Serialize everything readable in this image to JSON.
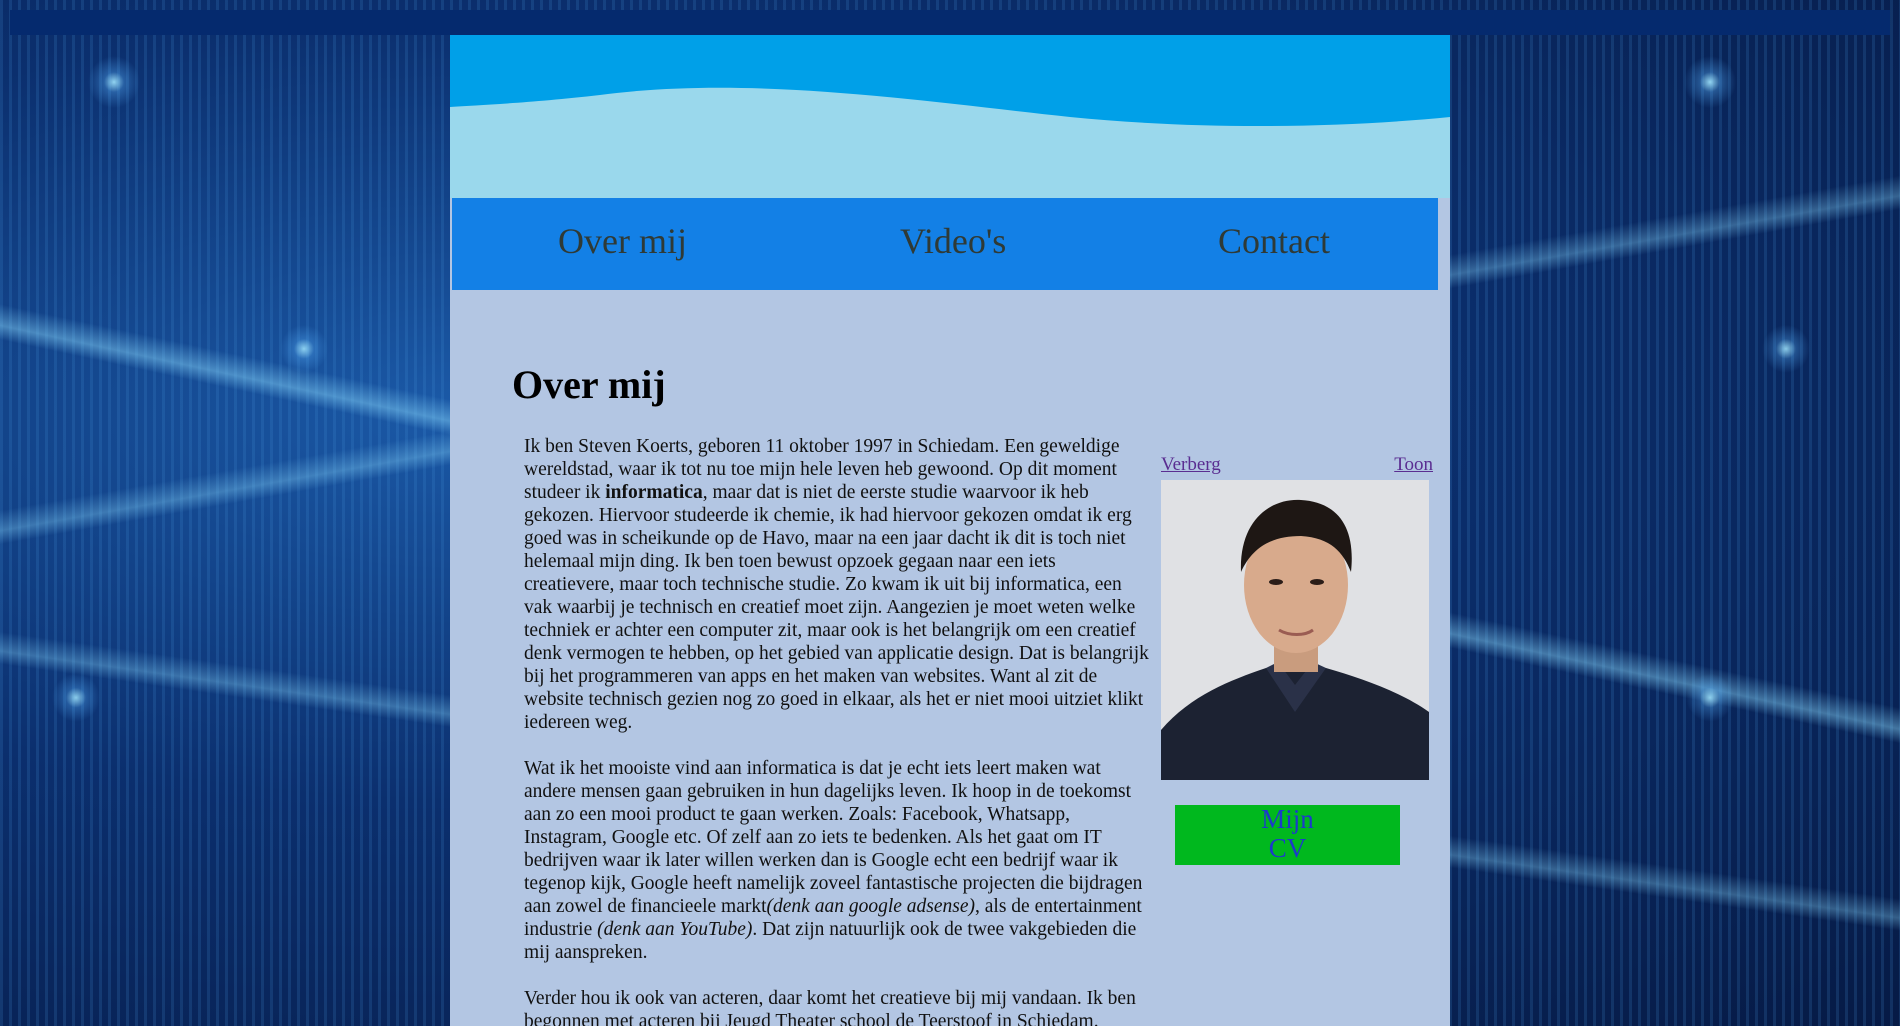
{
  "nav": {
    "items": [
      {
        "label": "Over mij"
      },
      {
        "label": "Video's"
      },
      {
        "label": "Contact"
      }
    ]
  },
  "main": {
    "title": "Over mij",
    "paragraphs": {
      "p1": {
        "before": "Ik ben Steven Koerts, geboren 11 oktober 1997 in Schiedam. Een geweldige wereldstad, waar ik tot nu toe mijn hele leven heb gewoond. Op dit moment studeer ik ",
        "bold": "informatica",
        "after": ", maar dat is niet de eerste studie waarvoor ik heb gekozen. Hiervoor studeerde ik chemie, ik had hiervoor gekozen omdat ik erg goed was in scheikunde op de Havo, maar na een jaar dacht ik dit is toch niet helemaal mijn ding. Ik ben toen bewust opzoek gegaan naar een iets creatievere, maar toch technische studie. Zo kwam ik uit bij informatica, een vak waarbij je technisch en creatief moet zijn. Aangezien je moet weten welke techniek er achter een computer zit, maar ook is het belangrijk om een creatief denk vermogen te hebben, op het gebied van applicatie design. Dat is belangrijk bij het programmeren van apps en het maken van websites. Want al zit de website technisch gezien nog zo goed in elkaar, als het er niet mooi uitziet klikt iedereen weg."
      },
      "p2": {
        "before": "Wat ik het mooiste vind aan informatica is dat je echt iets leert maken wat andere mensen gaan gebruiken in hun dagelijks leven. Ik hoop in de toekomst aan zo een mooi product te gaan werken. Zoals: Facebook, Whatsapp, Instagram, Google etc. Of zelf aan zo iets te bedenken. Als het gaat om IT bedrijven waar ik later willen werken dan is Google echt een bedrijf waar ik tegenop kijk, Google heeft namelijk zoveel fantastische projecten die bijdragen aan zowel de financieele markt",
        "italic1": "(denk aan google adsense)",
        "middle": ", als de entertainment industrie ",
        "italic2": "(denk aan YouTube)",
        "after": ". Dat zijn natuurlijk ook de twee vakgebieden die mij aanspreken."
      },
      "p3": {
        "text": "Verder hou ik ook van acteren, daar komt het creatieve bij mij vandaan. Ik ben begonnen met acteren bij Jeugd Theater school de Teerstoof in Schiedam."
      }
    }
  },
  "side": {
    "hide_label": "Verberg",
    "show_label": "Toon",
    "cv_line1": "Mijn",
    "cv_line2": "CV"
  },
  "colors": {
    "nav_bar": "#1380e6",
    "content_bg": "#b3c6e3",
    "cv_button": "#00b81e",
    "link": "#5a2d91"
  }
}
